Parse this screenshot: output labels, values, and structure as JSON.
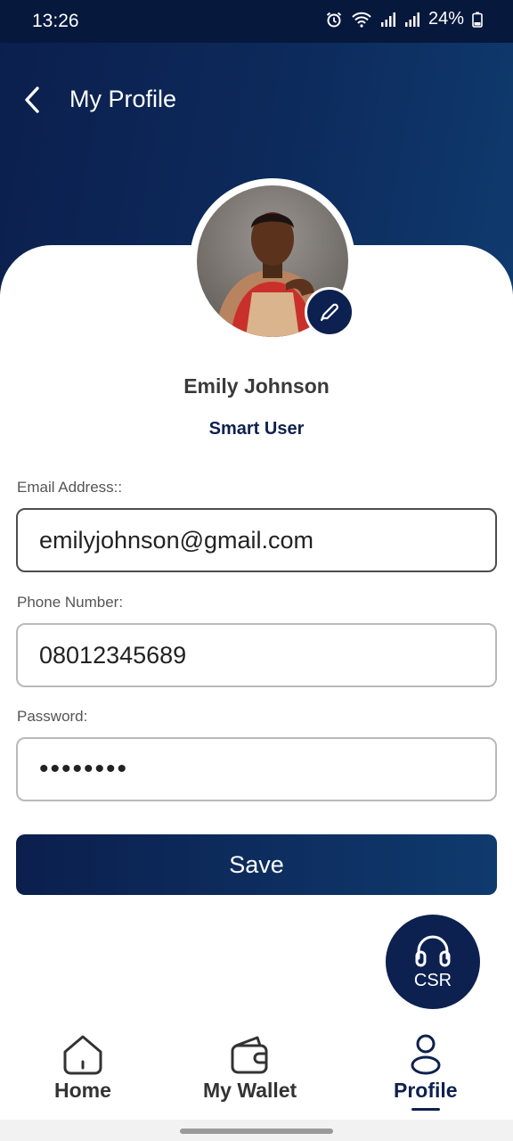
{
  "status_bar": {
    "time": "13:26",
    "battery": "24%"
  },
  "header": {
    "title": "My Profile"
  },
  "profile": {
    "name": "Emily Johnson",
    "role": "Smart User"
  },
  "form": {
    "email_label": "Email Address::",
    "email_value": "emilyjohnson@gmail.com",
    "phone_label": "Phone Number:",
    "phone_value": "08012345689",
    "password_label": "Password:",
    "password_value": "12345678",
    "save_label": "Save"
  },
  "csr": {
    "label": "CSR"
  },
  "bottom_nav": {
    "items": [
      {
        "label": "Home",
        "icon": "home-icon"
      },
      {
        "label": "My Wallet",
        "icon": "wallet-icon"
      },
      {
        "label": "Profile",
        "icon": "user-icon"
      }
    ],
    "active": "Profile"
  },
  "colors": {
    "primary": "#0d2150",
    "header_gradient_start": "#0b1f4d",
    "header_gradient_end": "#0f3a6e"
  }
}
